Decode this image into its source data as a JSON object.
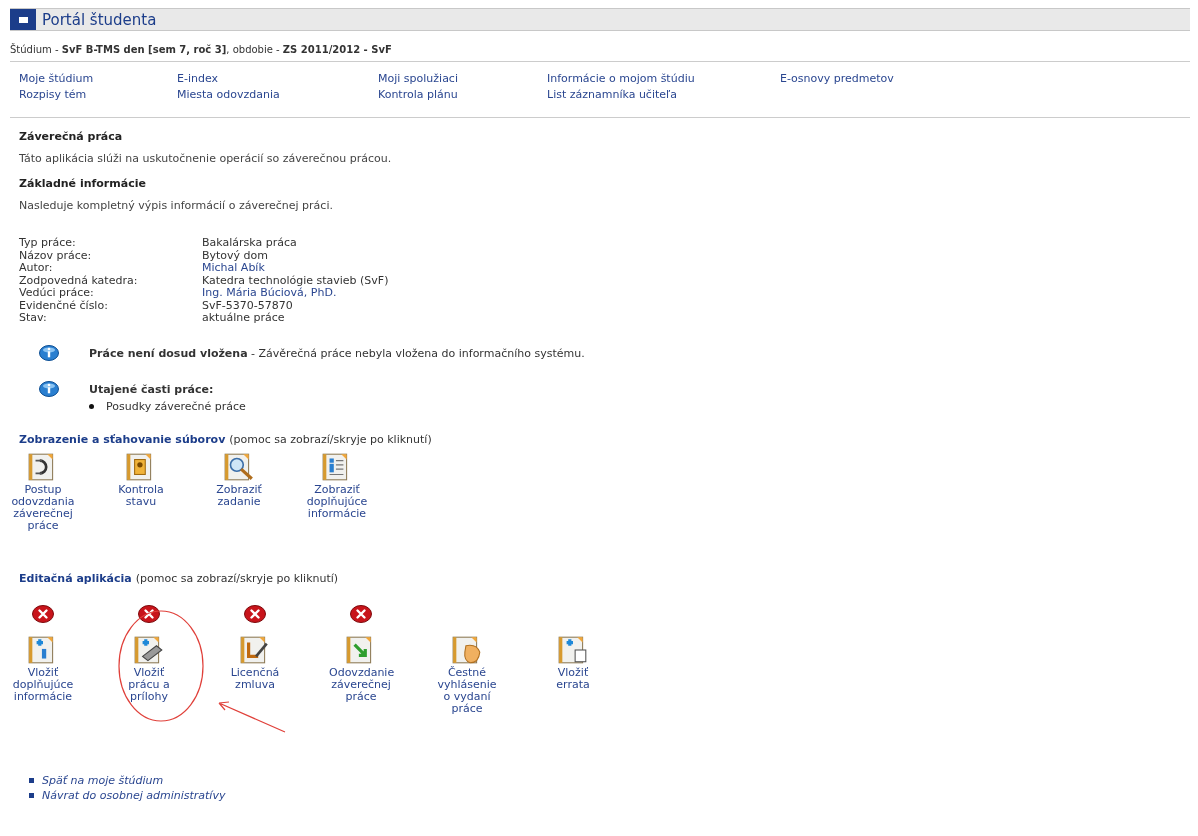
{
  "header": {
    "title": "Portál študenta"
  },
  "breadcrumb": [
    {
      "text": "Štúdium - ",
      "bold": false
    },
    {
      "text": "SvF B-TMS den [sem 7, roč 3]",
      "bold": true
    },
    {
      "text": ", obdobie - ",
      "bold": false
    },
    {
      "text": "ZS 2011/2012 - SvF",
      "bold": true
    }
  ],
  "nav": [
    {
      "label": "Moje štúdium"
    },
    {
      "label": "E-index"
    },
    {
      "label": "Moji spolužiaci"
    },
    {
      "label": "Informácie o mojom štúdiu"
    },
    {
      "label": "E-osnovy predmetov"
    },
    {
      "label": "Rozpisy tém"
    },
    {
      "label": "Miesta odovzdania"
    },
    {
      "label": "Kontrola plánu"
    },
    {
      "label": "List záznamníka učiteľa"
    }
  ],
  "title": "Záverečná práca",
  "description": "Táto aplikácia slúži na uskutočnenie operácií so záverečnou prácou.",
  "basic_heading": "Základné informácie",
  "basic_intro": "Nasleduje kompletný výpis informácií o záverečnej práci.",
  "info": [
    {
      "label": "Typ práce:",
      "value": "Bakalárska práca",
      "kind": "text"
    },
    {
      "label": "Názov práce:",
      "value": "Bytový dom",
      "kind": "text"
    },
    {
      "label": "Autor:",
      "value": "Michal Abík",
      "kind": "link"
    },
    {
      "label": "Zodpovedná katedra:",
      "value": "Katedra technológie stavieb (SvF)",
      "kind": "text"
    },
    {
      "label": "Vedúci práce:",
      "value": "Ing. Mária Búciová, PhD.",
      "kind": "link"
    },
    {
      "label": "Evidenčné číslo:",
      "value": "SvF-5370-57870",
      "kind": "text"
    },
    {
      "label": "Stav:",
      "value": "aktuálne práce",
      "kind": "text"
    }
  ],
  "notices": [
    {
      "text": "**Práce není dosud vložena** - Závěrečná práce nebyla vložena do informačního systému."
    },
    {
      "text": "**Utajené časti práce:**",
      "items": [
        "Posudky záverečné práce"
      ]
    }
  ],
  "sections": [
    {
      "title": "Zobrazenie a sťahovanie súborov",
      "hint": "(pomoc sa zobrazí/skryje po kliknutí)",
      "apps": [
        {
          "label": "Postup odovzdania záverečnej práce",
          "blocked": false
        },
        {
          "label": "Kontrola stavu",
          "blocked": false
        },
        {
          "label": "Zobraziť zadanie",
          "blocked": false
        },
        {
          "label": "Zobraziť doplňujúce informácie",
          "blocked": false
        }
      ]
    },
    {
      "title": "Editačná aplikácia",
      "hint": "(pomoc sa zobrazí/skryje po kliknutí)",
      "apps": [
        {
          "label": "Vložiť doplňujúce informácie",
          "blocked": true
        },
        {
          "label": "Vložiť prácu a prílohy",
          "blocked": true
        },
        {
          "label": "Licenčná zmluva",
          "blocked": true
        },
        {
          "label": "Odovzdanie záverečnej práce",
          "blocked": true
        },
        {
          "label": "Čestné vyhlásenie o vydaní práce",
          "blocked": false
        },
        {
          "label": "Vložiť errata",
          "blocked": false
        }
      ]
    }
  ],
  "links": [
    "Späť na moje štúdium",
    "Návrat do osobnej administratívy"
  ]
}
